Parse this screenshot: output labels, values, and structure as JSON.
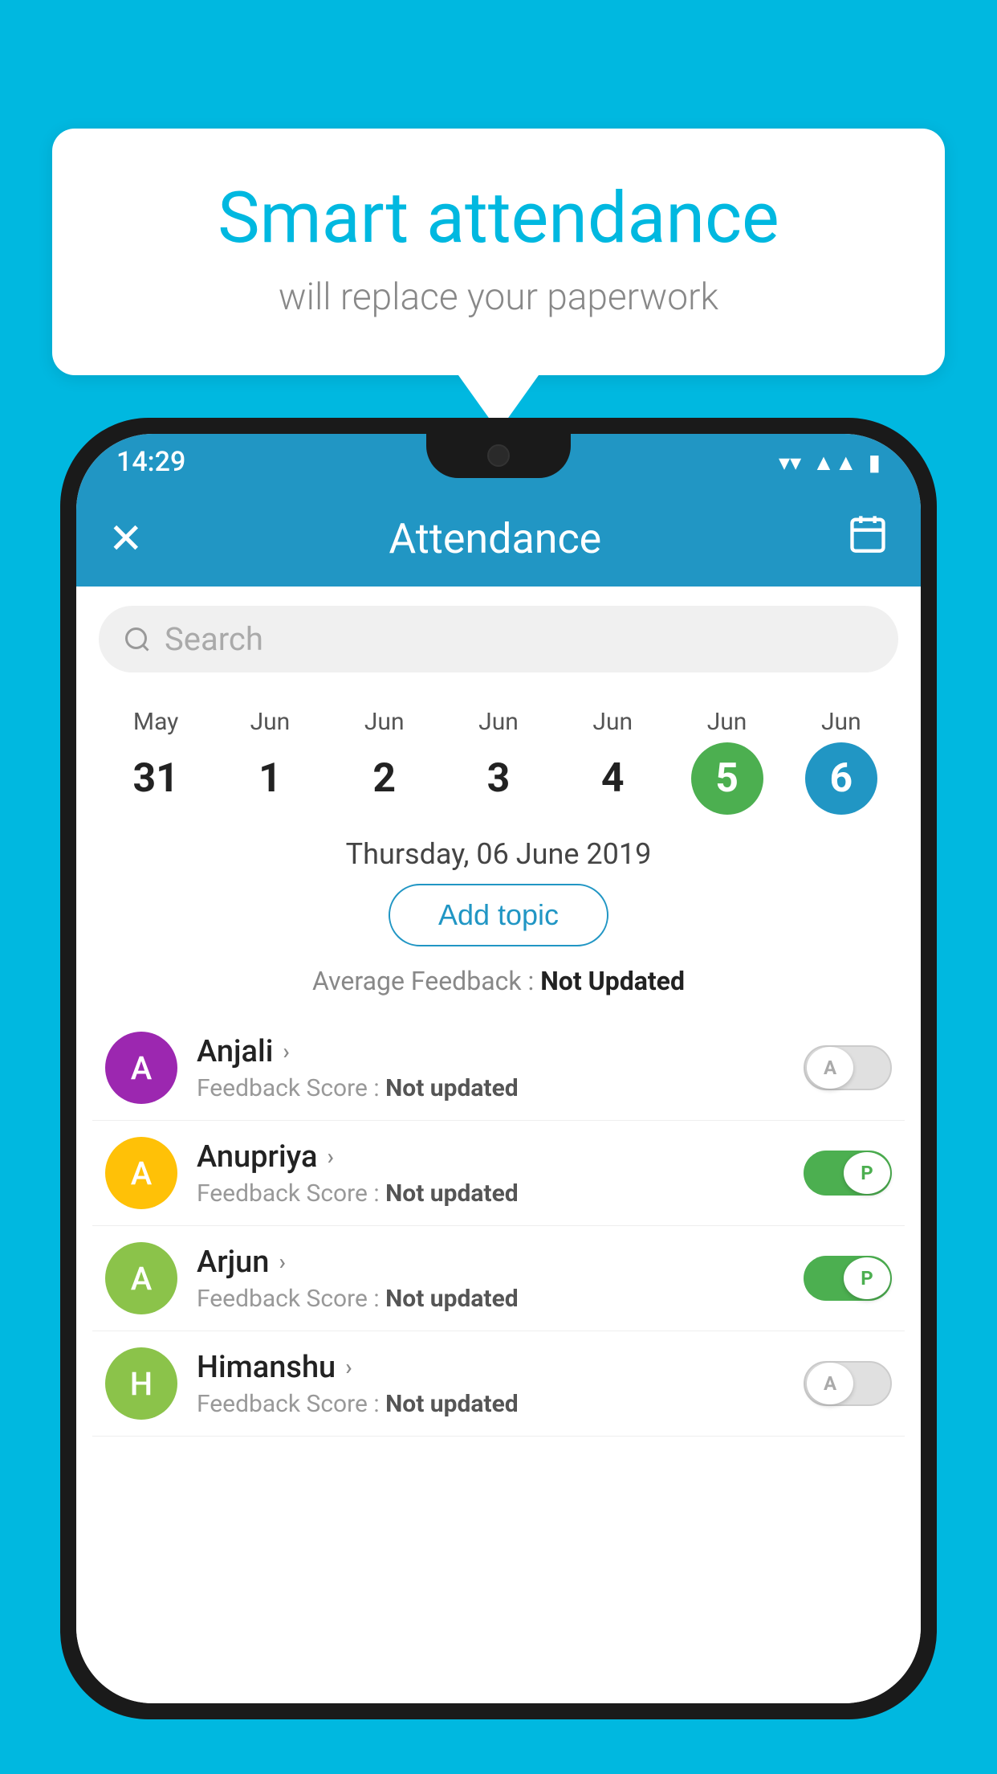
{
  "background_color": "#00B8E0",
  "bubble": {
    "title": "Smart attendance",
    "subtitle": "will replace your paperwork"
  },
  "status_bar": {
    "time": "14:29",
    "wifi_icon": "▼",
    "signal_icon": "▲",
    "battery_icon": "▮"
  },
  "app_bar": {
    "close_icon": "✕",
    "title": "Attendance",
    "calendar_icon": "📅"
  },
  "search": {
    "placeholder": "Search"
  },
  "calendar": {
    "days": [
      {
        "month": "May",
        "date": "31",
        "state": "normal"
      },
      {
        "month": "Jun",
        "date": "1",
        "state": "normal"
      },
      {
        "month": "Jun",
        "date": "2",
        "state": "normal"
      },
      {
        "month": "Jun",
        "date": "3",
        "state": "normal"
      },
      {
        "month": "Jun",
        "date": "4",
        "state": "normal"
      },
      {
        "month": "Jun",
        "date": "5",
        "state": "today"
      },
      {
        "month": "Jun",
        "date": "6",
        "state": "selected"
      }
    ]
  },
  "selected_date_label": "Thursday, 06 June 2019",
  "add_topic_label": "Add topic",
  "avg_feedback_label": "Average Feedback : ",
  "avg_feedback_value": "Not Updated",
  "students": [
    {
      "name": "Anjali",
      "avatar_letter": "A",
      "avatar_color": "#9C27B0",
      "feedback": "Feedback Score : ",
      "feedback_value": "Not updated",
      "toggle_state": "off",
      "toggle_letter": "A"
    },
    {
      "name": "Anupriya",
      "avatar_letter": "A",
      "avatar_color": "#FFC107",
      "feedback": "Feedback Score : ",
      "feedback_value": "Not updated",
      "toggle_state": "on",
      "toggle_letter": "P"
    },
    {
      "name": "Arjun",
      "avatar_letter": "A",
      "avatar_color": "#8BC34A",
      "feedback": "Feedback Score : ",
      "feedback_value": "Not updated",
      "toggle_state": "on",
      "toggle_letter": "P"
    },
    {
      "name": "Himanshu",
      "avatar_letter": "H",
      "avatar_color": "#8BC34A",
      "feedback": "Feedback Score : ",
      "feedback_value": "Not updated",
      "toggle_state": "off",
      "toggle_letter": "A"
    }
  ]
}
